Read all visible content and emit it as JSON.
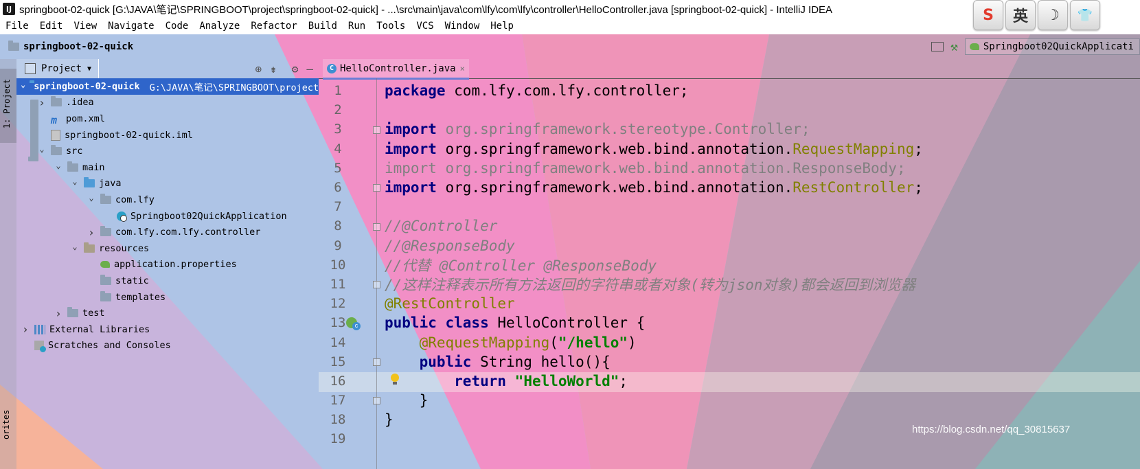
{
  "window": {
    "title": "springboot-02-quick [G:\\JAVA\\笔记\\SPRINGBOOT\\project\\springboot-02-quick] - ...\\src\\main\\java\\com\\lfy\\com\\lfy\\controller\\HelloController.java [springboot-02-quick] - IntelliJ IDEA",
    "app_icon_text": "IJ"
  },
  "ime_toolbar": [
    "S",
    "英",
    "☽",
    "👕"
  ],
  "menu": [
    "File",
    "Edit",
    "View",
    "Navigate",
    "Code",
    "Analyze",
    "Refactor",
    "Build",
    "Run",
    "Tools",
    "VCS",
    "Window",
    "Help"
  ],
  "navbar": {
    "project_name": "springboot-02-quick",
    "run_config": "Springboot02QuickApplicati"
  },
  "side_tabs": {
    "project": "1: Project",
    "favorites": "orites"
  },
  "project_panel": {
    "title": "Project",
    "tree": [
      {
        "label": "springboot-02-quick",
        "note": "G:\\JAVA\\笔记\\SPRINGBOOT\\project",
        "indent": 0,
        "arrow": "open",
        "icon": "folder-module",
        "selected": true
      },
      {
        "label": ".idea",
        "indent": 1,
        "arrow": "closed",
        "icon": "folder"
      },
      {
        "label": "pom.xml",
        "indent": 1,
        "arrow": "none",
        "icon": "maven"
      },
      {
        "label": "springboot-02-quick.iml",
        "indent": 1,
        "arrow": "none",
        "icon": "iml"
      },
      {
        "label": "src",
        "indent": 1,
        "arrow": "open",
        "icon": "folder"
      },
      {
        "label": "main",
        "indent": 2,
        "arrow": "open",
        "icon": "folder"
      },
      {
        "label": "java",
        "indent": 3,
        "arrow": "open",
        "icon": "folder-blue"
      },
      {
        "label": "com.lfy",
        "indent": 4,
        "arrow": "open",
        "icon": "package"
      },
      {
        "label": "Springboot02QuickApplication",
        "indent": 5,
        "arrow": "none",
        "icon": "spring-class"
      },
      {
        "label": "com.lfy.com.lfy.controller",
        "indent": 4,
        "arrow": "closed",
        "icon": "package"
      },
      {
        "label": "resources",
        "indent": 3,
        "arrow": "open",
        "icon": "folder-resources"
      },
      {
        "label": "application.properties",
        "indent": 4,
        "arrow": "none",
        "icon": "properties"
      },
      {
        "label": "static",
        "indent": 4,
        "arrow": "none",
        "icon": "folder"
      },
      {
        "label": "templates",
        "indent": 4,
        "arrow": "none",
        "icon": "folder"
      },
      {
        "label": "test",
        "indent": 2,
        "arrow": "closed",
        "icon": "folder"
      },
      {
        "label": "External Libraries",
        "indent": 0,
        "arrow": "closed",
        "icon": "libraries"
      },
      {
        "label": "Scratches and Consoles",
        "indent": 0,
        "arrow": "none",
        "icon": "scratches"
      }
    ]
  },
  "editor": {
    "tab_label": "HelloController.java",
    "tab_close": "×",
    "lines": [
      {
        "n": "1",
        "tokens": [
          [
            "kw",
            "package"
          ],
          [
            "txt",
            " com.lfy.com.lfy.controller;"
          ]
        ]
      },
      {
        "n": "2",
        "tokens": []
      },
      {
        "n": "3",
        "tokens": [
          [
            "kw",
            "import"
          ],
          [
            "grey",
            " org.springframework.stereotype.Controller;"
          ]
        ]
      },
      {
        "n": "4",
        "tokens": [
          [
            "kw",
            "import"
          ],
          [
            "txt",
            " org.springframework.web.bind.annotation."
          ],
          [
            "ann",
            "RequestMapping"
          ],
          [
            "txt",
            ";"
          ]
        ]
      },
      {
        "n": "5",
        "tokens": [
          [
            "grey",
            "import org.springframework.web.bind.annotation.ResponseBody;"
          ]
        ]
      },
      {
        "n": "6",
        "tokens": [
          [
            "kw",
            "import"
          ],
          [
            "txt",
            " org.springframework.web.bind.annotation."
          ],
          [
            "ann",
            "RestController"
          ],
          [
            "txt",
            ";"
          ]
        ]
      },
      {
        "n": "7",
        "tokens": []
      },
      {
        "n": "8",
        "tokens": [
          [
            "comment",
            "//@Controller"
          ]
        ]
      },
      {
        "n": "9",
        "tokens": [
          [
            "comment",
            "//@ResponseBody"
          ]
        ]
      },
      {
        "n": "10",
        "tokens": [
          [
            "comment",
            "//代替 @Controller @ResponseBody"
          ]
        ]
      },
      {
        "n": "11",
        "tokens": [
          [
            "comment",
            "//这样注释表示所有方法返回的字符串或者对象(转为json对象)都会返回到浏览器"
          ]
        ]
      },
      {
        "n": "12",
        "tokens": [
          [
            "ann",
            "@RestController"
          ]
        ]
      },
      {
        "n": "13",
        "tokens": [
          [
            "kw",
            "public class"
          ],
          [
            "txt",
            " HelloController {"
          ]
        ]
      },
      {
        "n": "14",
        "tokens": [
          [
            "txt",
            "    "
          ],
          [
            "ann",
            "@RequestMapping"
          ],
          [
            "txt",
            "("
          ],
          [
            "str",
            "\"/hello\""
          ],
          [
            "txt",
            ")"
          ]
        ]
      },
      {
        "n": "15",
        "tokens": [
          [
            "txt",
            "    "
          ],
          [
            "kw",
            "public"
          ],
          [
            "txt",
            " String hello(){"
          ]
        ]
      },
      {
        "n": "16",
        "tokens": [
          [
            "txt",
            "        "
          ],
          [
            "kw",
            "return"
          ],
          [
            "txt",
            " "
          ],
          [
            "str",
            "\"HelloWorld\""
          ],
          [
            "txt",
            ";"
          ]
        ]
      },
      {
        "n": "17",
        "tokens": [
          [
            "txt",
            "    }"
          ]
        ]
      },
      {
        "n": "18",
        "tokens": [
          [
            "txt",
            "}"
          ]
        ]
      },
      {
        "n": "19",
        "tokens": []
      }
    ]
  },
  "watermark": "https://blog.csdn.net/qq_30815637",
  "colors": {
    "selection": "#2f65ca",
    "keyword": "#000080",
    "annotation": "#808000",
    "string": "#008000",
    "comment": "#808080"
  }
}
